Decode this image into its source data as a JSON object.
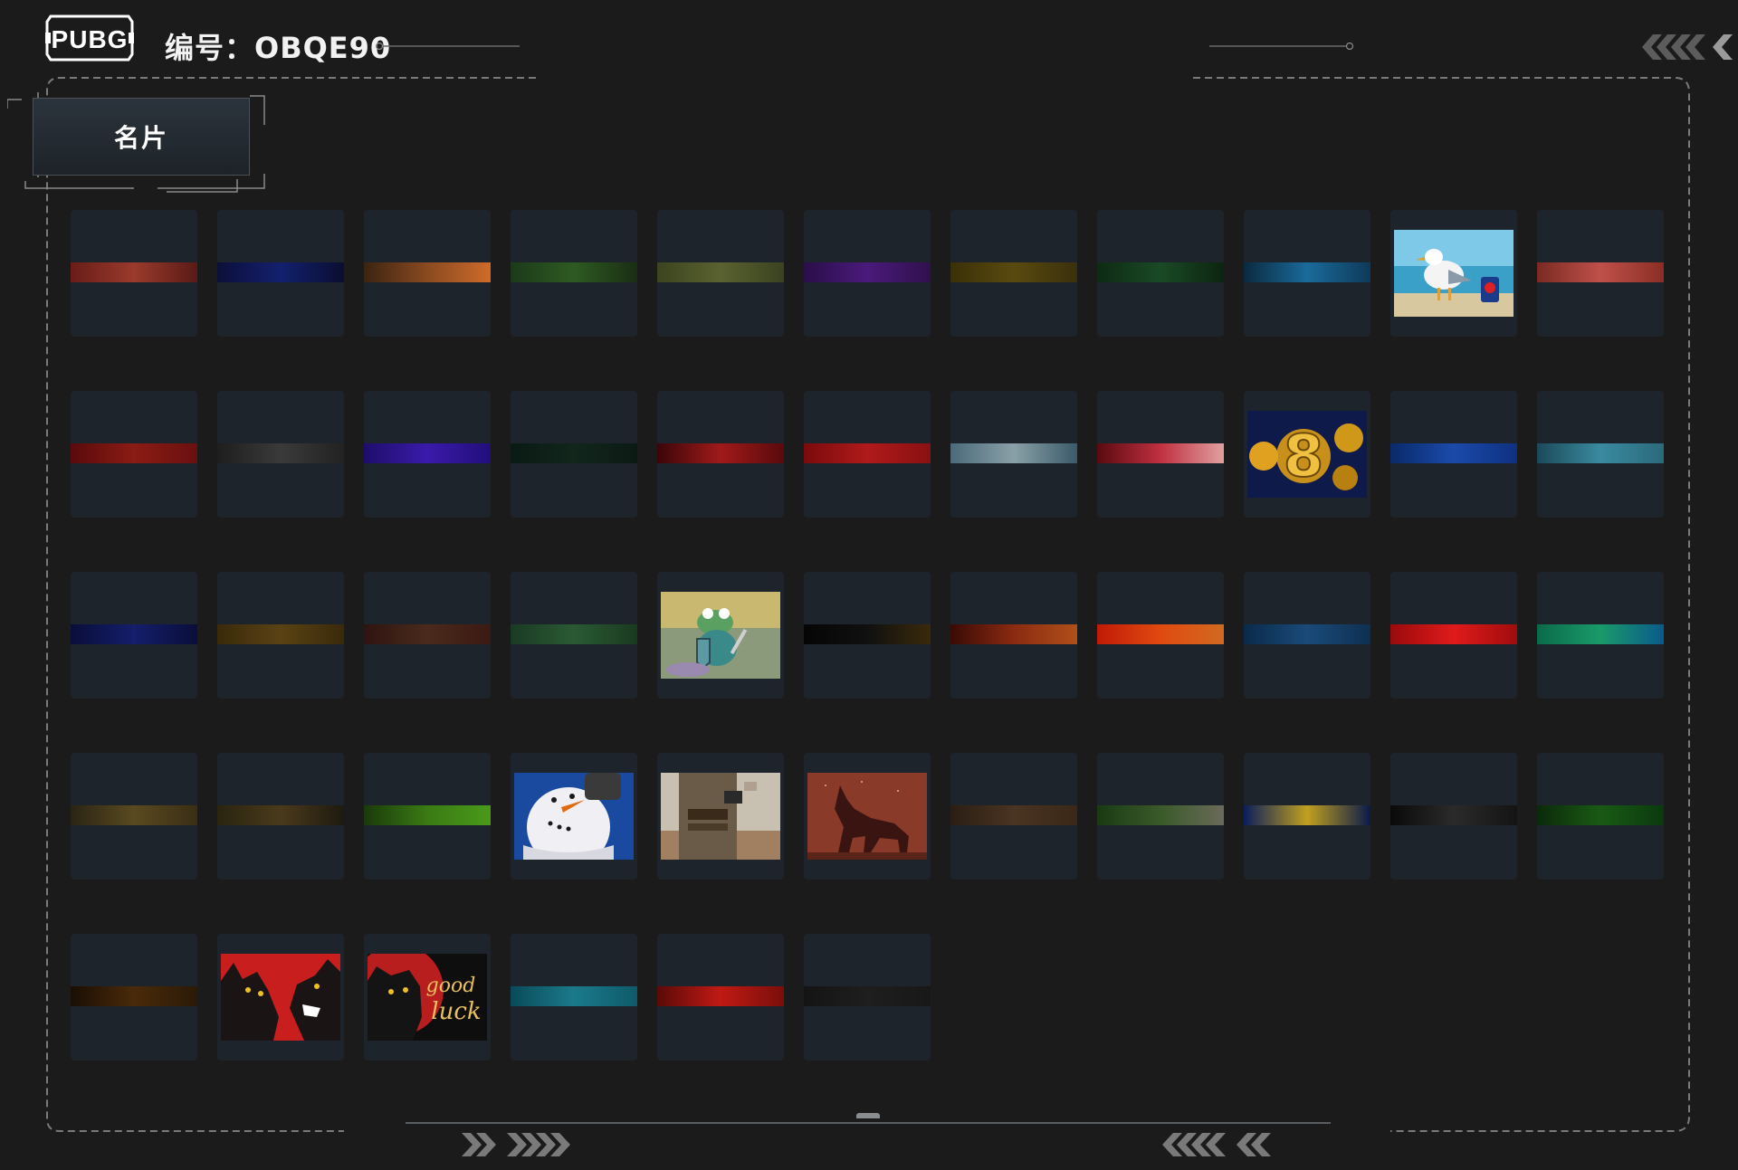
{
  "header": {
    "logo_text": "PUBG",
    "code_label": "编号：OBQE90"
  },
  "section": {
    "title": "名片"
  },
  "cards": [
    {
      "kind": "strip",
      "colors": [
        "#6a1c18",
        "#9a3a2c",
        "#5a1a16"
      ]
    },
    {
      "kind": "strip",
      "colors": [
        "#0c0f3a",
        "#13206e",
        "#0a0e30"
      ]
    },
    {
      "kind": "strip",
      "colors": [
        "#3a2412",
        "#8a4a20",
        "#d06a2a"
      ]
    },
    {
      "kind": "strip",
      "colors": [
        "#1c3a1a",
        "#2e5a22",
        "#1a2e14"
      ]
    },
    {
      "kind": "strip",
      "colors": [
        "#3c4420",
        "#5a6230",
        "#3a4220"
      ]
    },
    {
      "kind": "strip",
      "colors": [
        "#2a0e4a",
        "#4a1a7a",
        "#30104e"
      ]
    },
    {
      "kind": "strip",
      "colors": [
        "#3a3008",
        "#5a4a10",
        "#3a300c"
      ]
    },
    {
      "kind": "strip",
      "colors": [
        "#0e2a14",
        "#1a4a26",
        "#0c2410"
      ]
    },
    {
      "kind": "strip",
      "colors": [
        "#0a2a40",
        "#1a6a9a",
        "#0e3a5a"
      ]
    },
    {
      "kind": "image",
      "name": "seagull-image"
    },
    {
      "kind": "strip",
      "colors": [
        "#7a2a22",
        "#c0504a",
        "#8a2e24"
      ]
    },
    {
      "kind": "strip",
      "colors": [
        "#5a0a0c",
        "#8a1c14",
        "#6a1010"
      ]
    },
    {
      "kind": "strip",
      "colors": [
        "#1e1e1e",
        "#3a3a3a",
        "#222222"
      ]
    },
    {
      "kind": "strip",
      "colors": [
        "#1e0e6a",
        "#3a1aaa",
        "#220e7a"
      ]
    },
    {
      "kind": "strip",
      "colors": [
        "#0a1a14",
        "#12261c",
        "#0c1a14"
      ]
    },
    {
      "kind": "strip",
      "colors": [
        "#3a0608",
        "#a01a1a",
        "#5a0a0c"
      ]
    },
    {
      "kind": "strip",
      "colors": [
        "#7a0a0c",
        "#b01a1a",
        "#8a1012"
      ]
    },
    {
      "kind": "strip",
      "colors": [
        "#4a6a7a",
        "#8aa0a8",
        "#3a5a6a"
      ]
    },
    {
      "kind": "strip",
      "colors": [
        "#5a0a10",
        "#c03040",
        "#e0a0a0"
      ]
    },
    {
      "kind": "image",
      "name": "gold-88-image"
    },
    {
      "kind": "strip",
      "colors": [
        "#0a2a6a",
        "#1a4aaa",
        "#0e3080"
      ]
    },
    {
      "kind": "strip",
      "colors": [
        "#1a4a5a",
        "#3a8aa0",
        "#2a6a7a"
      ]
    },
    {
      "kind": "strip",
      "colors": [
        "#0a0e3a",
        "#141e6a",
        "#0a0e3a"
      ]
    },
    {
      "kind": "strip",
      "colors": [
        "#3a2a0a",
        "#5a4214",
        "#3a2a0a"
      ]
    },
    {
      "kind": "strip",
      "colors": [
        "#2e1410",
        "#4a2a1c",
        "#3a1a12"
      ]
    },
    {
      "kind": "strip",
      "colors": [
        "#1a3a24",
        "#2a5a34",
        "#1a3a20"
      ]
    },
    {
      "kind": "image",
      "name": "frog-knight-image"
    },
    {
      "kind": "strip",
      "colors": [
        "#050505",
        "#101010",
        "#3a2a0a"
      ]
    },
    {
      "kind": "strip",
      "colors": [
        "#3a0a06",
        "#8a2a10",
        "#b0501a"
      ]
    },
    {
      "kind": "strip",
      "colors": [
        "#c01a06",
        "#e04a10",
        "#d06a20"
      ]
    },
    {
      "kind": "strip",
      "colors": [
        "#0a2a4a",
        "#1a4a7a",
        "#0e3050"
      ]
    },
    {
      "kind": "strip",
      "colors": [
        "#9a0a0c",
        "#e01a1a",
        "#a00c0c"
      ]
    },
    {
      "kind": "strip",
      "colors": [
        "#0a6a4a",
        "#1a9a6a",
        "#0a5a8a"
      ]
    },
    {
      "kind": "strip",
      "colors": [
        "#2a2414",
        "#5a4a20",
        "#3a2e14"
      ]
    },
    {
      "kind": "strip",
      "colors": [
        "#2a2410",
        "#4a3a1a",
        "#1e1a10"
      ]
    },
    {
      "kind": "strip",
      "colors": [
        "#1a3a0a",
        "#3a7a14",
        "#4a9a1a"
      ]
    },
    {
      "kind": "image",
      "name": "snowman-image"
    },
    {
      "kind": "image",
      "name": "soldier-image"
    },
    {
      "kind": "image",
      "name": "howling-wolf-image"
    },
    {
      "kind": "strip",
      "colors": [
        "#2a1e14",
        "#4a3422",
        "#3a2818"
      ]
    },
    {
      "kind": "strip",
      "colors": [
        "#1a3a14",
        "#3a5a2a",
        "#6a6a5a"
      ]
    },
    {
      "kind": "strip",
      "colors": [
        "#0a1e5a",
        "#c0a020",
        "#0a1a4a"
      ]
    },
    {
      "kind": "strip",
      "colors": [
        "#0a0a0a",
        "#2a2a2a",
        "#141414"
      ]
    },
    {
      "kind": "strip",
      "colors": [
        "#0a2a0a",
        "#1a5a14",
        "#0a3a0e"
      ]
    },
    {
      "kind": "strip",
      "colors": [
        "#1a0e04",
        "#4a2a0a",
        "#2a1a06"
      ]
    },
    {
      "kind": "image",
      "name": "wolves-red-image"
    },
    {
      "kind": "image",
      "name": "good-luck-panther-image"
    },
    {
      "kind": "strip",
      "colors": [
        "#0a4a5a",
        "#1a7a8a",
        "#0e5a6a"
      ]
    },
    {
      "kind": "strip",
      "colors": [
        "#5a0a08",
        "#c01a14",
        "#7a0e0a"
      ]
    },
    {
      "kind": "strip",
      "colors": [
        "#141414",
        "#1e1e1e",
        "#181818"
      ]
    }
  ],
  "good_luck_text": "good luck"
}
